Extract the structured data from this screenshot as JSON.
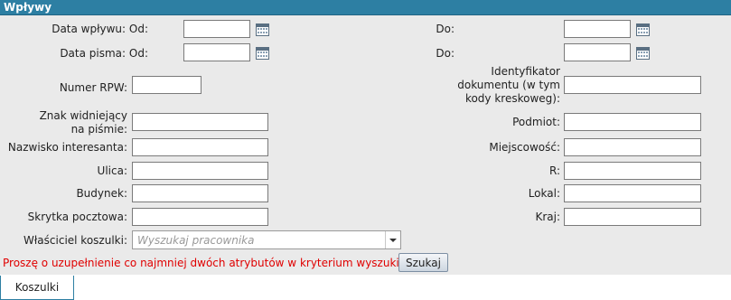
{
  "section_title": "Wpływy",
  "fields": {
    "data_wplywu_label": "Data wpływu: Od:",
    "data_wplywu_od": "",
    "data_wplywu_do_label": "Do:",
    "data_wplywu_do": "",
    "data_pisma_label": "Data pisma: Od:",
    "data_pisma_od": "",
    "data_pisma_do_label": "Do:",
    "data_pisma_do": "",
    "numer_rpw_label": "Numer RPW:",
    "numer_rpw": "",
    "identyfikator_label": "Identyfikator dokumentu (w tym kody kreskoweg):",
    "identyfikator": "",
    "znak_label": "Znak widniejący na piśmie:",
    "znak": "",
    "podmiot_label": "Podmiot:",
    "podmiot": "",
    "nazwisko_label": "Nazwisko interesanta:",
    "nazwisko": "",
    "miejscowosc_label": "Miejscowość:",
    "miejscowosc": "",
    "ulica_label": "Ulica:",
    "ulica": "",
    "r_label": "R:",
    "r": "",
    "budynek_label": "Budynek:",
    "budynek": "",
    "lokal_label": "Lokal:",
    "lokal": "",
    "skrytka_label": "Skrytka pocztowa:",
    "skrytka": "",
    "kraj_label": "Kraj:",
    "kraj": "",
    "wlasciciel_label": "Właściciel koszulki:",
    "wlasciciel_placeholder": "Wyszukaj pracownika"
  },
  "warning": "Proszę o uzupełnienie co najmniej dwóch atrybutów w kryterium wyszukiwania !",
  "search_button": "Szukaj",
  "tab_label": "Koszulki",
  "icons": {
    "calendar": "calendar-icon",
    "dropdown": "chevron-down-icon"
  },
  "colors": {
    "header": "#2d7fa3",
    "panel": "#eaeaea",
    "warning": "#e00000"
  }
}
